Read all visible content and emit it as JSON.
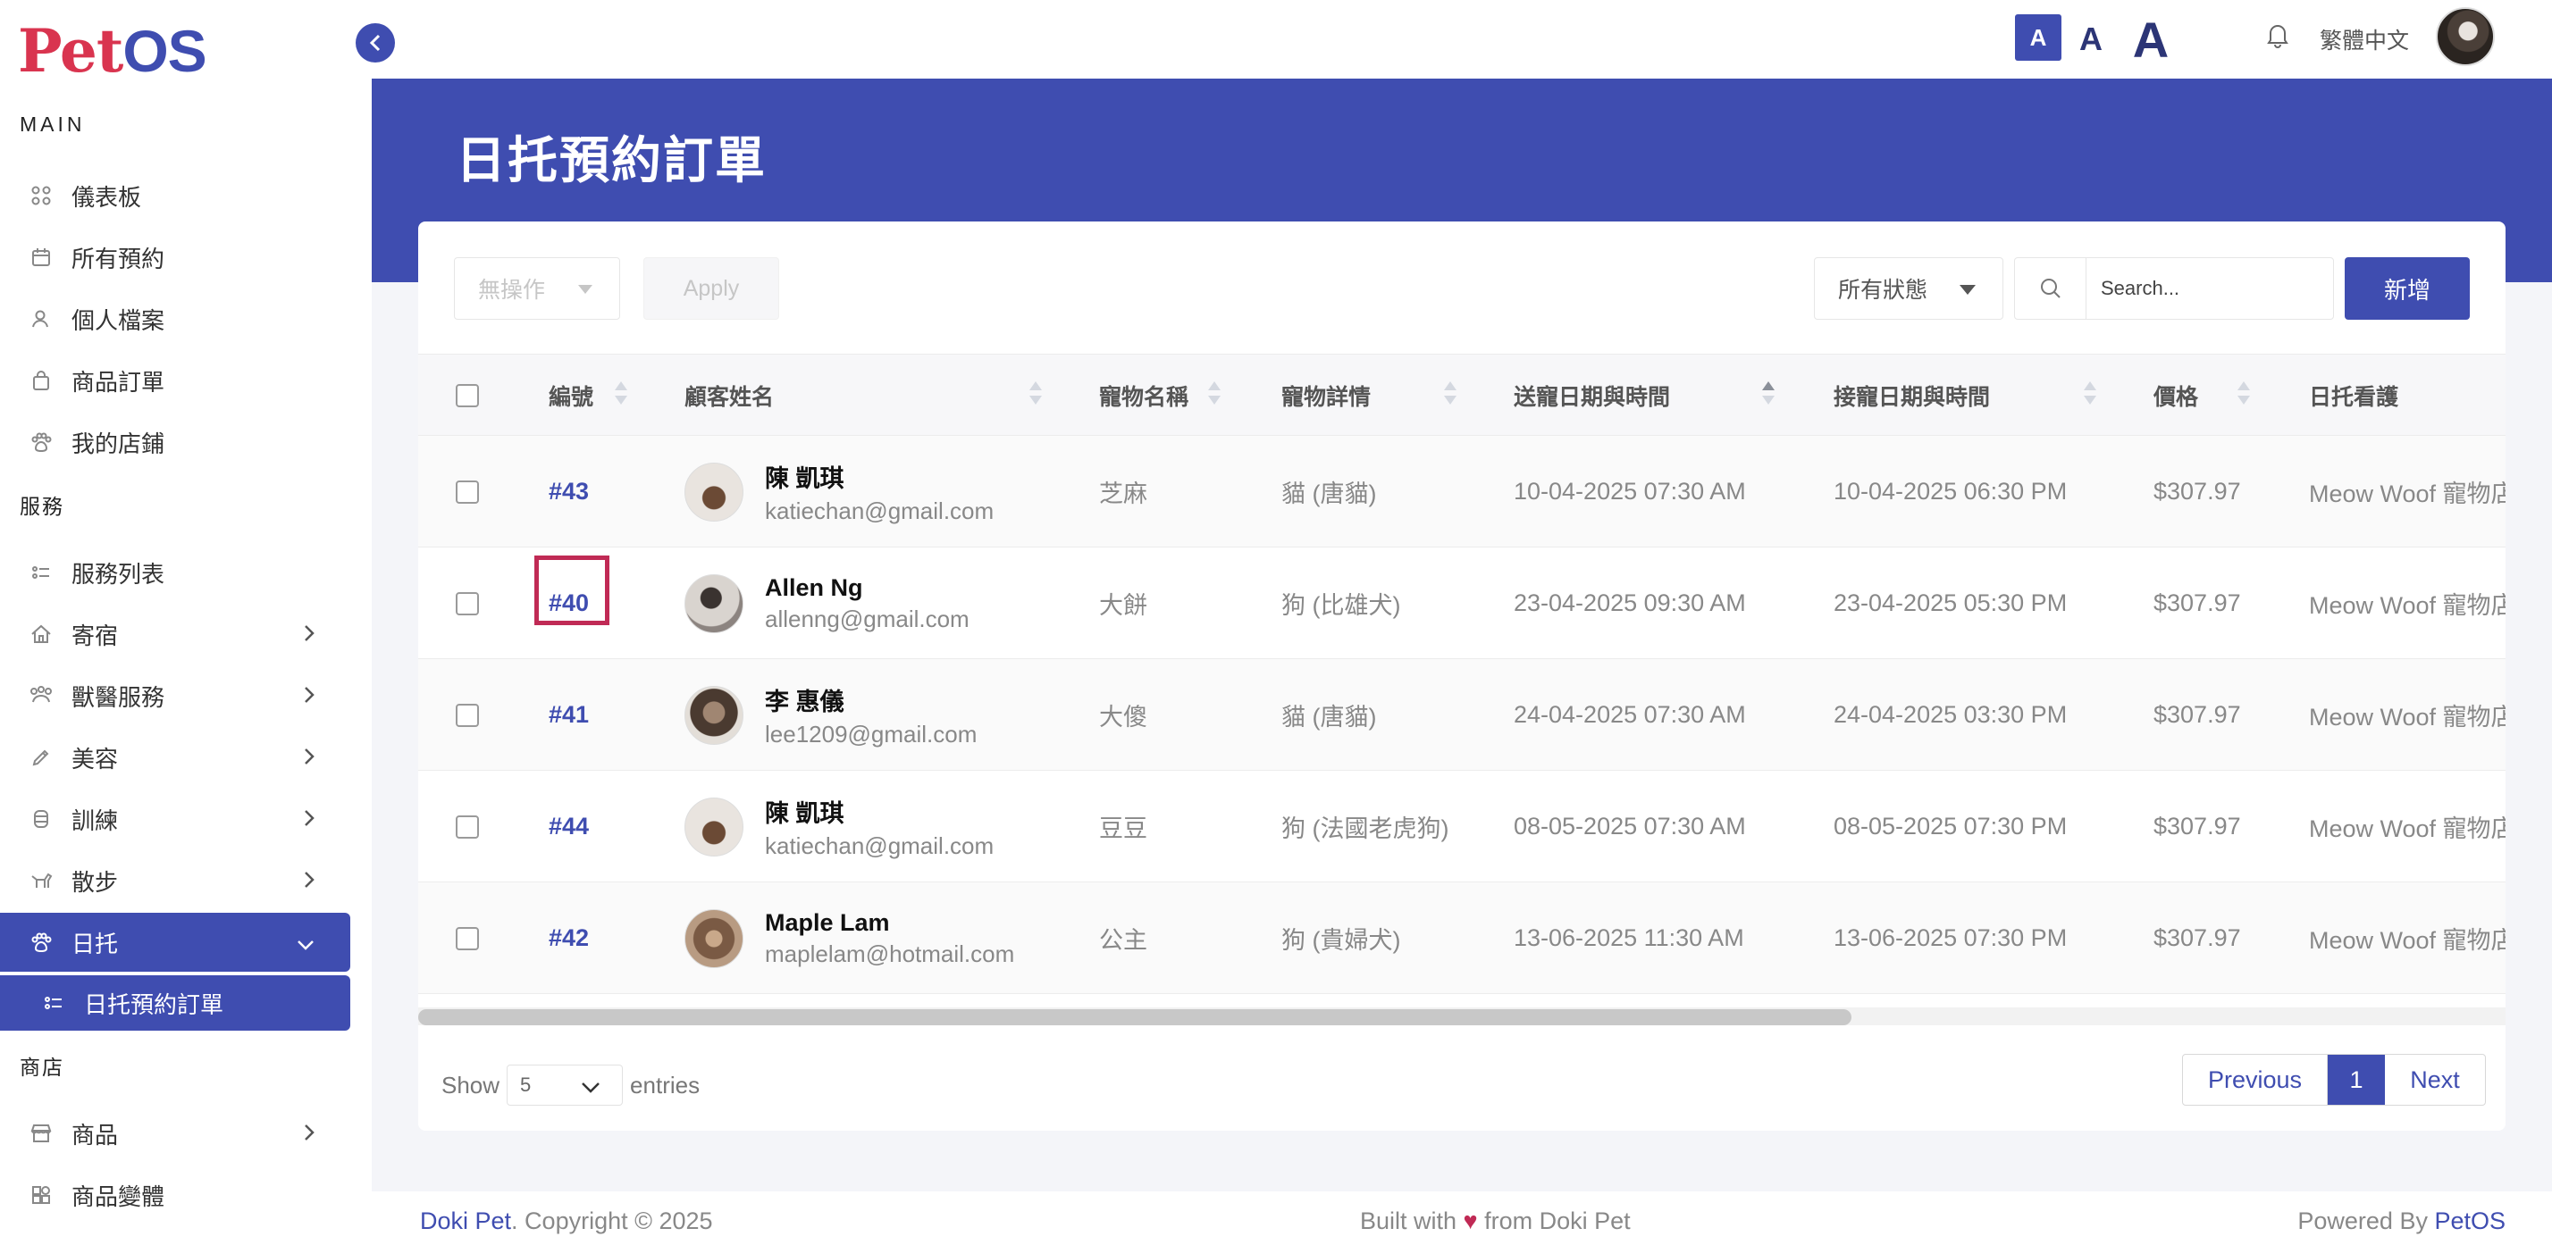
{
  "brand": {
    "logo_p": "P",
    "logo_et": "et",
    "logo_os": "OS"
  },
  "sidebar": {
    "section_main": "MAIN",
    "main_items": [
      {
        "label": "儀表板",
        "icon": "grid-icon"
      },
      {
        "label": "所有預約",
        "icon": "calendar-icon"
      },
      {
        "label": "個人檔案",
        "icon": "user-icon"
      },
      {
        "label": "商品訂單",
        "icon": "bag-icon"
      },
      {
        "label": "我的店鋪",
        "icon": "paw-icon"
      }
    ],
    "section_services": "服務",
    "service_items": [
      {
        "label": "服務列表",
        "icon": "list-icon"
      },
      {
        "label": "寄宿",
        "icon": "house-icon"
      },
      {
        "label": "獸醫服務",
        "icon": "vet-icon"
      },
      {
        "label": "美容",
        "icon": "brush-icon"
      },
      {
        "label": "訓練",
        "icon": "bowl-icon"
      },
      {
        "label": "散步",
        "icon": "walk-icon"
      },
      {
        "label": "日托",
        "icon": "paw-icon"
      },
      {
        "label": "日托預約訂單",
        "icon": "list-icon"
      }
    ],
    "section_shop": "商店",
    "shop_items": [
      {
        "label": "商品",
        "icon": "store-icon"
      },
      {
        "label": "商品變體",
        "icon": "variant-icon"
      }
    ]
  },
  "topbar": {
    "font_small": "A",
    "font_medium": "A",
    "font_large": "A",
    "language": "繁體中文"
  },
  "page": {
    "title": "日托預約訂單"
  },
  "toolbar": {
    "bulk_action": "無操作",
    "apply_label": "Apply",
    "status_filter": "所有狀態",
    "search_placeholder": "Search...",
    "add_label": "新增"
  },
  "table": {
    "columns": [
      "編號",
      "顧客姓名",
      "寵物名稱",
      "寵物詳情",
      "送寵日期與時間",
      "接寵日期與時間",
      "價格",
      "日托看護"
    ],
    "rows": [
      {
        "id": "#43",
        "name": "陳 凱琪",
        "email": "katiechan@gmail.com",
        "pet": "芝麻",
        "detail": "貓 (唐貓)",
        "dropoff": "10-04-2025 07:30 AM",
        "pickup": "10-04-2025 06:30 PM",
        "price": "$307.97",
        "carer": "Meow Woof 寵物店"
      },
      {
        "id": "#40",
        "name": "Allen Ng",
        "email": "allenng@gmail.com",
        "pet": "大餅",
        "detail": "狗 (比雄犬)",
        "dropoff": "23-04-2025 09:30 AM",
        "pickup": "23-04-2025 05:30 PM",
        "price": "$307.97",
        "carer": "Meow Woof 寵物店"
      },
      {
        "id": "#41",
        "name": "李 惠儀",
        "email": "lee1209@gmail.com",
        "pet": "大傻",
        "detail": "貓 (唐貓)",
        "dropoff": "24-04-2025 07:30 AM",
        "pickup": "24-04-2025 03:30 PM",
        "price": "$307.97",
        "carer": "Meow Woof 寵物店"
      },
      {
        "id": "#44",
        "name": "陳 凱琪",
        "email": "katiechan@gmail.com",
        "pet": "豆豆",
        "detail": "狗 (法國老虎狗)",
        "dropoff": "08-05-2025 07:30 AM",
        "pickup": "08-05-2025 07:30 PM",
        "price": "$307.97",
        "carer": "Meow Woof 寵物店"
      },
      {
        "id": "#42",
        "name": "Maple Lam",
        "email": "maplelam@hotmail.com",
        "pet": "公主",
        "detail": "狗 (貴婦犬)",
        "dropoff": "13-06-2025 11:30 AM",
        "pickup": "13-06-2025 07:30 PM",
        "price": "$307.97",
        "carer": "Meow Woof 寵物店"
      }
    ]
  },
  "pagination": {
    "show_label": "Show",
    "page_size": "5",
    "entries_label": "entries",
    "previous": "Previous",
    "current": "1",
    "next": "Next"
  },
  "footer": {
    "company": "Doki Pet",
    "copyright": ". Copyright © 2025",
    "built_pre": "Built with ",
    "built_post": " from Doki Pet",
    "powered_pre": "Powered By ",
    "powered_brand": "PetOS"
  },
  "colors": {
    "primary": "#3f4db0",
    "accent": "#c02a55"
  }
}
